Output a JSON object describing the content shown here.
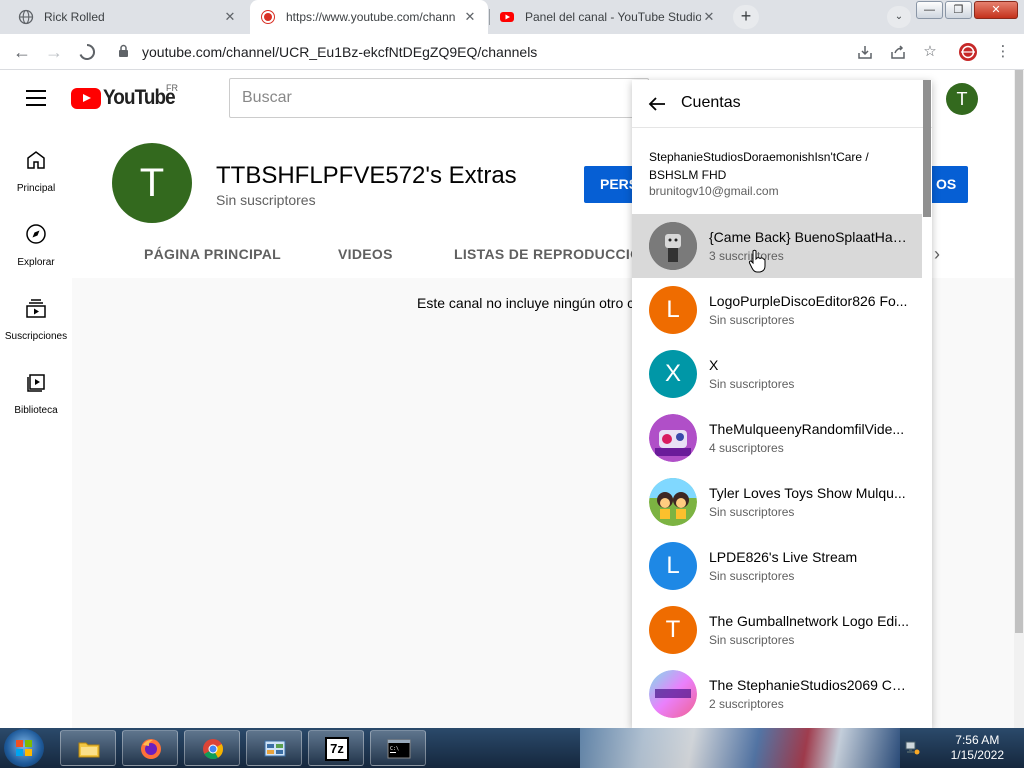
{
  "browser": {
    "tabs": [
      {
        "title": "Rick Rolled",
        "active": false
      },
      {
        "title": "https://www.youtube.com/chann",
        "active": true
      },
      {
        "title": "Panel del canal - YouTube Studio",
        "active": false
      }
    ],
    "new_tab_label": "+",
    "tab_search_label": "⌄",
    "url": "youtube.com/channel/UCR_Eu1Bz-ekcfNtDEgZQ9EQ/channels"
  },
  "youtube": {
    "logo_text": "YouTube",
    "region": "FR",
    "search_placeholder": "Buscar",
    "user_initial": "T"
  },
  "guide": [
    {
      "label": "Principal",
      "icon": "home-icon"
    },
    {
      "label": "Explorar",
      "icon": "compass-icon"
    },
    {
      "label": "Suscripciones",
      "icon": "subscriptions-icon"
    },
    {
      "label": "Biblioteca",
      "icon": "library-icon"
    }
  ],
  "channel": {
    "initial": "T",
    "name": "TTBSHFLPFVE572's Extras",
    "subscribers": "Sin suscriptores",
    "button_left": "PERS",
    "button_right": "OS",
    "tabs": [
      "PÁGINA PRINCIPAL",
      "VIDEOS",
      "LISTAS DE REPRODUCCIÓN"
    ],
    "empty_message": "Este canal no incluye ningún otro c"
  },
  "accounts_panel": {
    "title": "Cuentas",
    "account_name": "StephanieStudiosDoraemonishIsn'tCare / BSHSLM FHD",
    "account_email": "brunitogv10@gmail.com",
    "channels": [
      {
        "name": "{Came Back} BuenoSplaatHay...",
        "subs": "3 suscriptores",
        "initial": "",
        "color": "#555555",
        "selected": true
      },
      {
        "name": "LogoPurpleDiscoEditor826 Fo...",
        "subs": "Sin suscriptores",
        "initial": "L",
        "color": "#ef6c00",
        "selected": false
      },
      {
        "name": "X",
        "subs": "Sin suscriptores",
        "initial": "X",
        "color": "#0097a7",
        "selected": false
      },
      {
        "name": "TheMulqueenyRandomfilVide...",
        "subs": "4 suscriptores",
        "initial": "",
        "color": "#8e44ad",
        "selected": false
      },
      {
        "name": "Tyler Loves Toys Show Mulqu...",
        "subs": "Sin suscriptores",
        "initial": "",
        "color": "#2e7d32",
        "selected": false
      },
      {
        "name": "LPDE826's Live Stream",
        "subs": "Sin suscriptores",
        "initial": "L",
        "color": "#1e88e5",
        "selected": false
      },
      {
        "name": "The Gumballnetwork Logo Edi...",
        "subs": "Sin suscriptores",
        "initial": "T",
        "color": "#ef6c00",
        "selected": false
      },
      {
        "name": "The StephanieStudios2069 Co...",
        "subs": "2 suscriptores",
        "initial": "",
        "color": "#e040fb",
        "selected": false
      }
    ]
  },
  "taskbar": {
    "apps": [
      "explorer-icon",
      "firefox-icon",
      "chrome-icon",
      "control-panel-icon",
      "7zip-icon",
      "cmd-icon"
    ],
    "sevenzip_label": "7z",
    "time": "7:56 AM",
    "date": "1/15/2022"
  },
  "colors": {
    "youtube_red": "#ff0000",
    "accent_blue": "#065fd4",
    "avatar_green": "#33691e"
  }
}
